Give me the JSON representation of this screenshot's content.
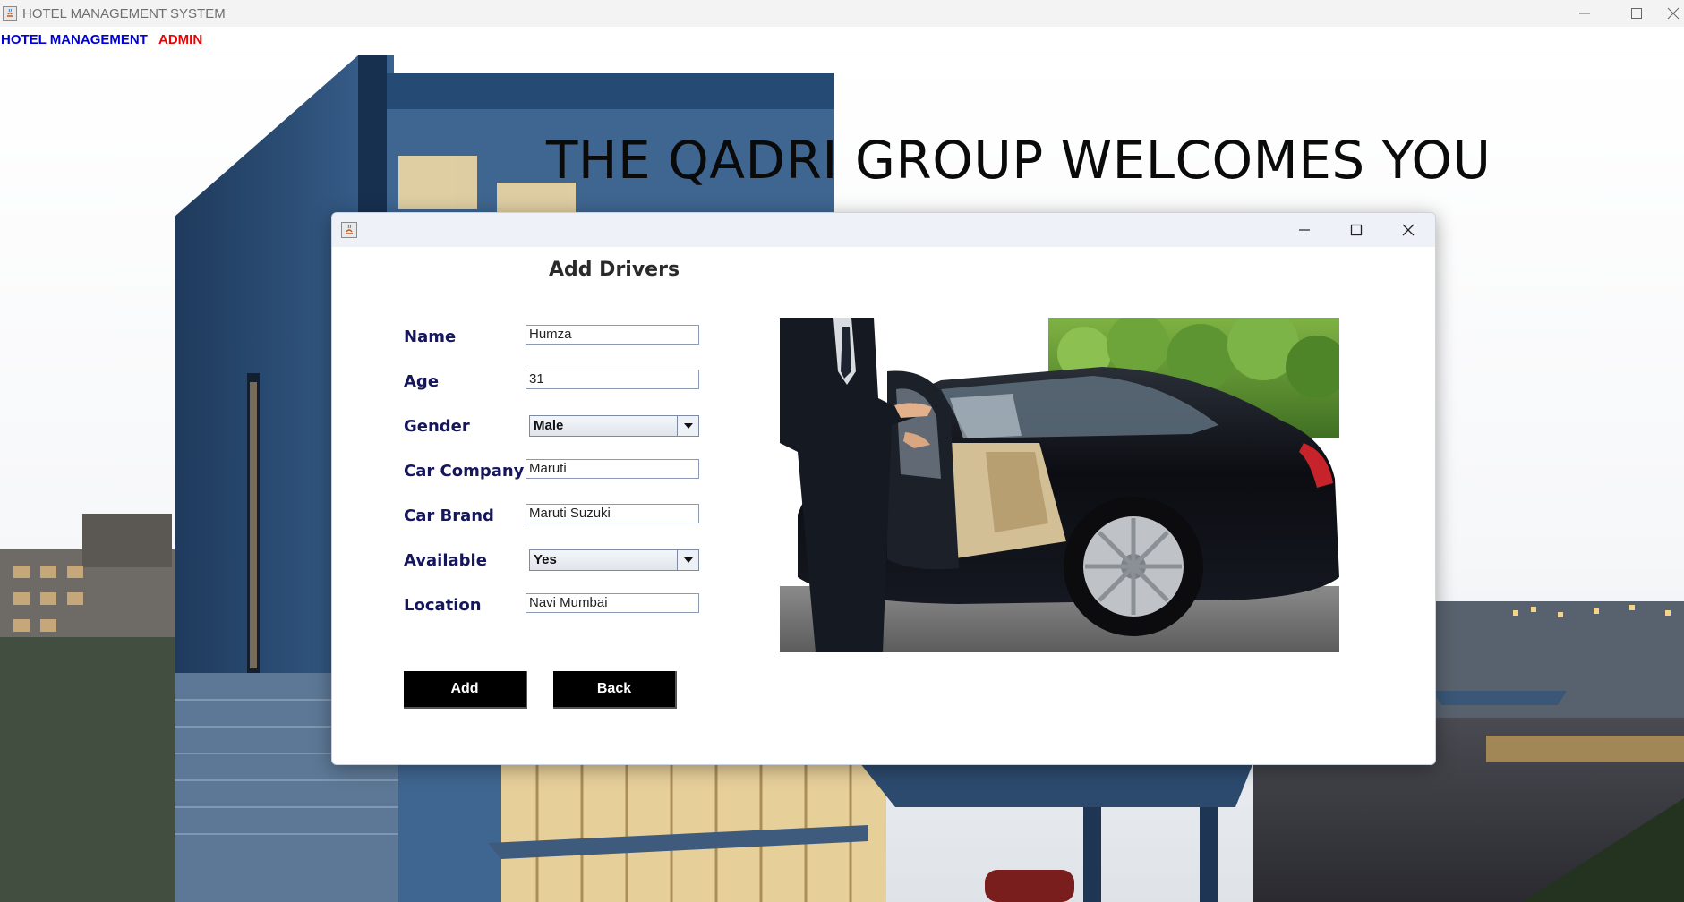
{
  "window": {
    "title": "HOTEL MANAGEMENT SYSTEM"
  },
  "menubar": {
    "items": [
      {
        "label": "HOTEL MANAGEMENT",
        "color": "#0000dd"
      },
      {
        "label": "ADMIN",
        "color": "#ee0000"
      }
    ]
  },
  "background": {
    "welcome_text": "THE QADRI GROUP WELCOMES YOU"
  },
  "dialog": {
    "heading": "Add Drivers",
    "fields": {
      "name": {
        "label": "Name",
        "value": "Humza"
      },
      "age": {
        "label": "Age",
        "value": "31"
      },
      "gender": {
        "label": "Gender",
        "value": "Male"
      },
      "car_company": {
        "label": "Car Company",
        "value": "Maruti"
      },
      "car_brand": {
        "label": "Car Brand",
        "value": "Maruti Suzuki"
      },
      "available": {
        "label": "Available",
        "value": "Yes"
      },
      "location": {
        "label": "Location",
        "value": "Navi Mumbai"
      }
    },
    "buttons": {
      "add": "Add",
      "back": "Back"
    }
  },
  "colors": {
    "label_color": "#16165c",
    "button_bg": "#000000",
    "button_text": "#ffffff"
  }
}
